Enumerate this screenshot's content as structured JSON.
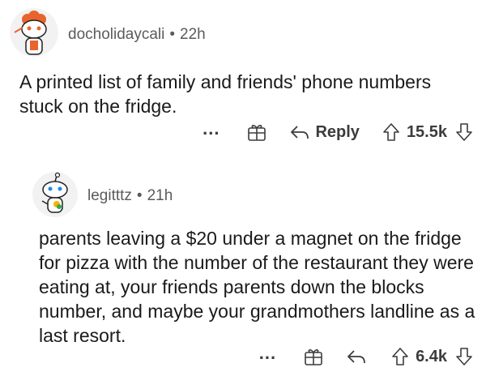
{
  "comments": [
    {
      "author": "docholidaycali",
      "separator": "•",
      "age": "22h",
      "body": "A printed list of family and friends' phone numbers stuck on the fridge.",
      "actions": {
        "more_label": "...",
        "reply_label": "Reply",
        "score": "15.5k"
      },
      "icons": [
        "avatar",
        "more-icon",
        "gift-icon",
        "reply-icon",
        "upvote-icon",
        "downvote-icon"
      ]
    },
    {
      "author": "legitttz",
      "separator": "•",
      "age": "21h",
      "body": "parents leaving a $20 under a magnet on the fridge for pizza with the number of the restaurant they were eating at, your friends parents down the blocks number, and maybe your grandmothers landline as a last resort.",
      "actions": {
        "more_label": "...",
        "score": "6.4k"
      },
      "icons": [
        "avatar",
        "more-icon",
        "gift-icon",
        "reply-icon",
        "upvote-icon",
        "downvote-icon"
      ]
    }
  ],
  "colors": {
    "text": "#1a1a1b",
    "meta": "#5b5b5d",
    "icon": "#3c3c3f",
    "accent_orange": "#e8642c"
  }
}
